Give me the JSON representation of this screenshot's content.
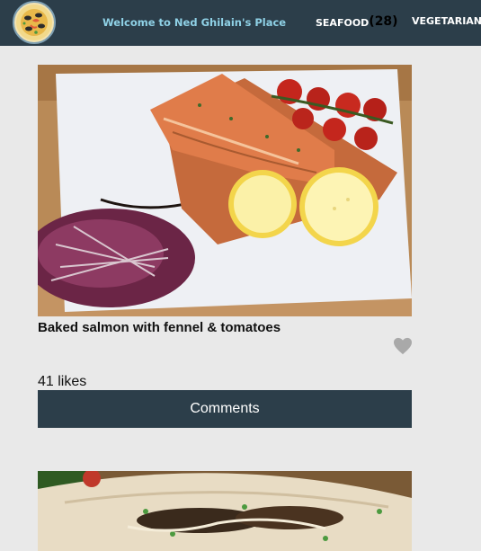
{
  "header": {
    "site_title": "Welcome to Ned Ghilain's Place",
    "nav": [
      {
        "label": "SEAFOOD",
        "count": "(28)"
      },
      {
        "label": "VEGETARIAN"
      }
    ]
  },
  "posts": [
    {
      "title": "Baked salmon with fennel & tomatoes",
      "likes": "41 likes",
      "comments_label": "Comments",
      "image": "baked-salmon-photo"
    },
    {
      "image": "fish-tacos-photo"
    }
  ],
  "colors": {
    "header_bg": "#2c3e4a",
    "title_accent": "#8fd1e6",
    "page_bg": "#e9e9e9",
    "heart": "#a9a9a9"
  }
}
